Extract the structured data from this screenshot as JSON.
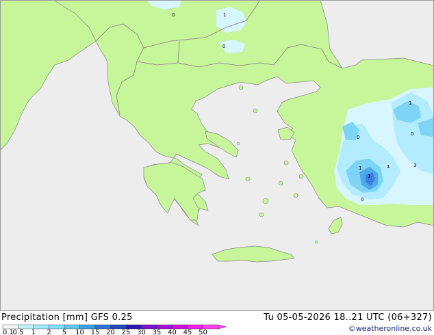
{
  "title": {
    "label": "Precipitation [mm]",
    "model": "GFS 0.25",
    "valid_time": "Tu 05-05-2026 18..21 UTC (06+327)",
    "copyright": "©weatheronline.co.uk"
  },
  "legend": {
    "ticks": [
      "0.1",
      "0.5",
      "1",
      "2",
      "5",
      "10",
      "15",
      "20",
      "25",
      "30",
      "35",
      "40",
      "45",
      "50"
    ],
    "colors": [
      "#f5f5f5",
      "#bff4ff",
      "#a0ecff",
      "#7ee0ff",
      "#5ec8f0",
      "#3a9ee8",
      "#2f72d8",
      "#2448c0",
      "#2a18b0",
      "#7a12d0",
      "#a010d8",
      "#d010d8",
      "#f020e8",
      "#ff40f0"
    ]
  },
  "map": {
    "colors": {
      "sea": "#ededed",
      "land": "#c6f59a",
      "border": "#808080",
      "coast": "#8a8a8a",
      "precip_light": "#d8f6ff",
      "precip_low": "#b4ecff",
      "precip_mid": "#7ed4f5",
      "precip_high": "#4fa8e8",
      "precip_peak": "#3a7ee0"
    },
    "contour_labels": [
      "0",
      "1",
      "0",
      "1",
      "0",
      "0",
      "1",
      "1",
      "1",
      "0",
      "3"
    ]
  }
}
